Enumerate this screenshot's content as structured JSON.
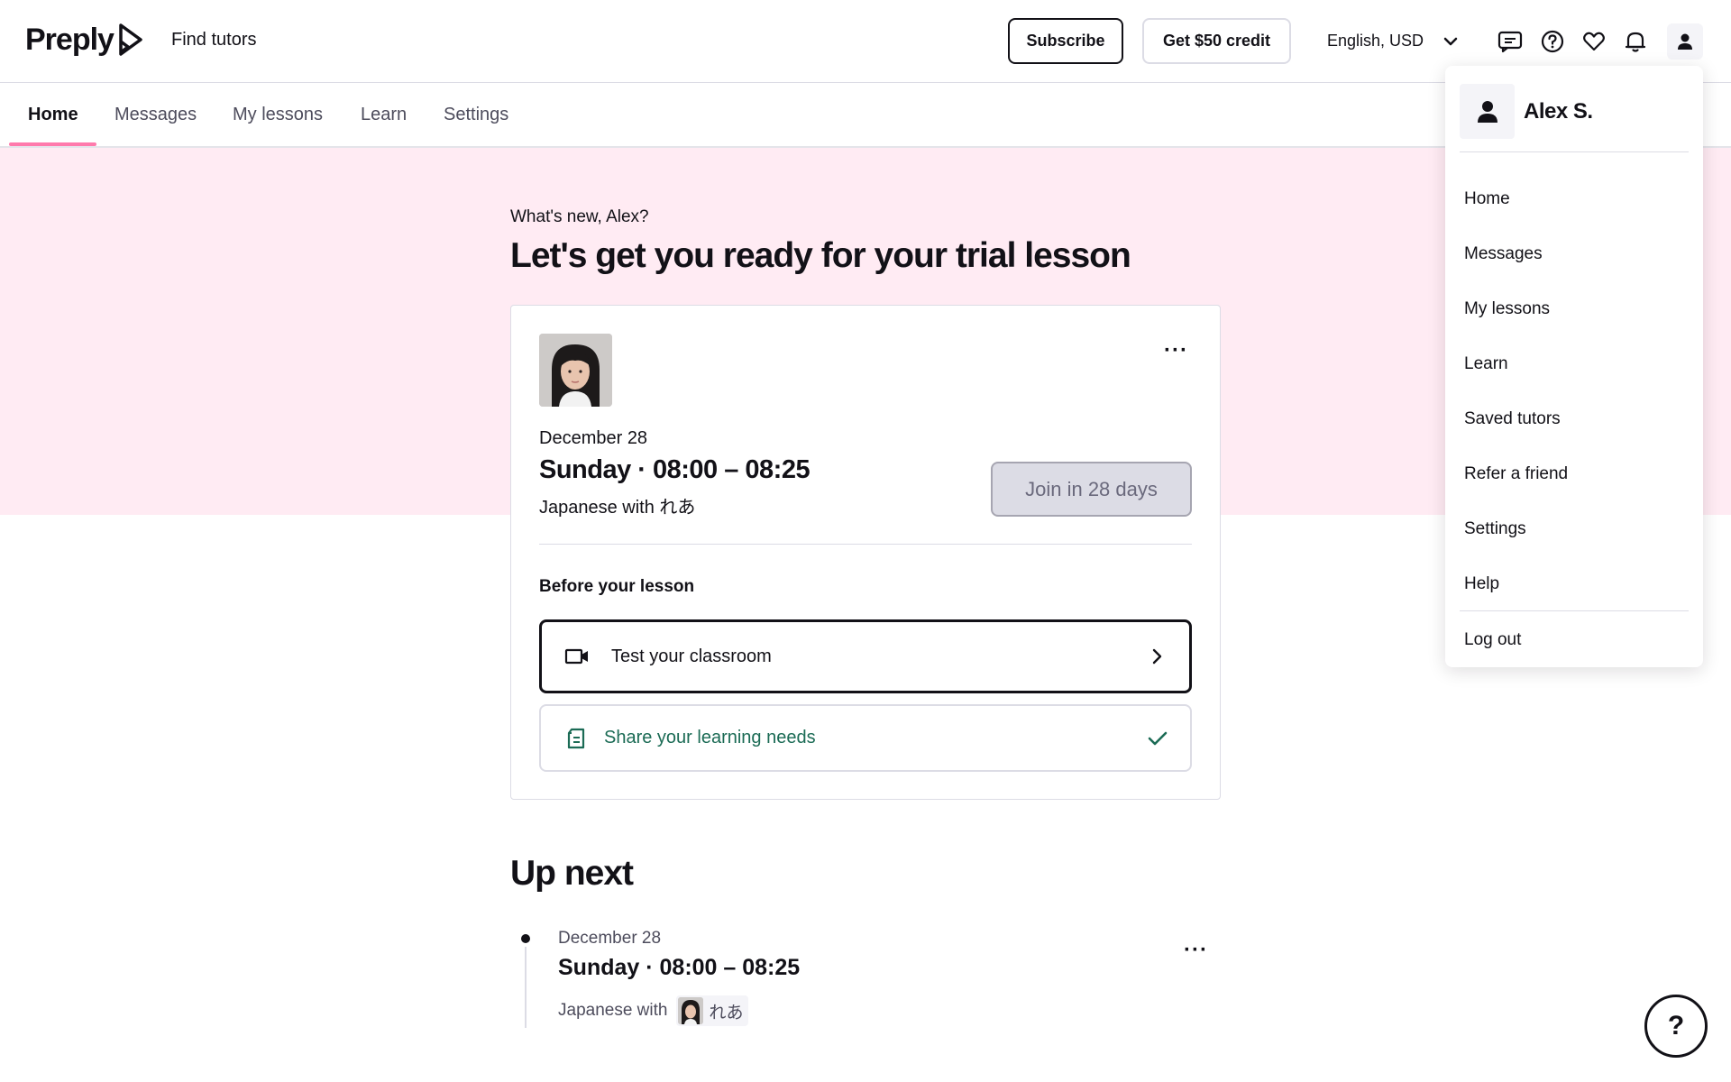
{
  "header": {
    "brand": "Preply",
    "find_tutors": "Find tutors",
    "subscribe_label": "Subscribe",
    "credit_label": "Get $50 credit",
    "language_currency": "English, USD",
    "icons": [
      "messages-icon",
      "help-icon",
      "heart-icon",
      "bell-icon",
      "user-icon"
    ]
  },
  "tabs": [
    {
      "label": "Home",
      "active": true
    },
    {
      "label": "Messages",
      "active": false
    },
    {
      "label": "My lessons",
      "active": false
    },
    {
      "label": "Learn",
      "active": false
    },
    {
      "label": "Settings",
      "active": false
    }
  ],
  "main": {
    "greeting": "What's new, Alex?",
    "headline": "Let's get you ready for your trial lesson"
  },
  "lesson_card": {
    "more_label": "···",
    "date": "December 28",
    "time": "Sunday · 08:00 – 08:25",
    "subject": "Japanese with れあ",
    "join_label": "Join in 28 days",
    "before_title": "Before your lesson",
    "tasks": [
      {
        "label": "Test your classroom",
        "icon": "video-camera-icon",
        "status_icon": "chevron-right-icon",
        "completed": false
      },
      {
        "label": "Share your learning needs",
        "icon": "document-icon",
        "status_icon": "checkmark-icon",
        "completed": true
      }
    ]
  },
  "up_next": {
    "title": "Up next",
    "date": "December 28",
    "time": "Sunday · 08:00 – 08:25",
    "subject_prefix": "Japanese with",
    "tutor_name": "れあ",
    "more_label": "···"
  },
  "user_menu": {
    "name": "Alex S.",
    "items": [
      "Home",
      "Messages",
      "My lessons",
      "Learn",
      "Saved tutors",
      "Refer a friend",
      "Settings",
      "Help"
    ],
    "logout": "Log out"
  },
  "help_fab": {
    "label": "?"
  },
  "colors": {
    "accent_pink": "#ff7aac",
    "banner_pink": "#ffebf3",
    "success_green": "#1b6b55",
    "text": "#121117"
  }
}
